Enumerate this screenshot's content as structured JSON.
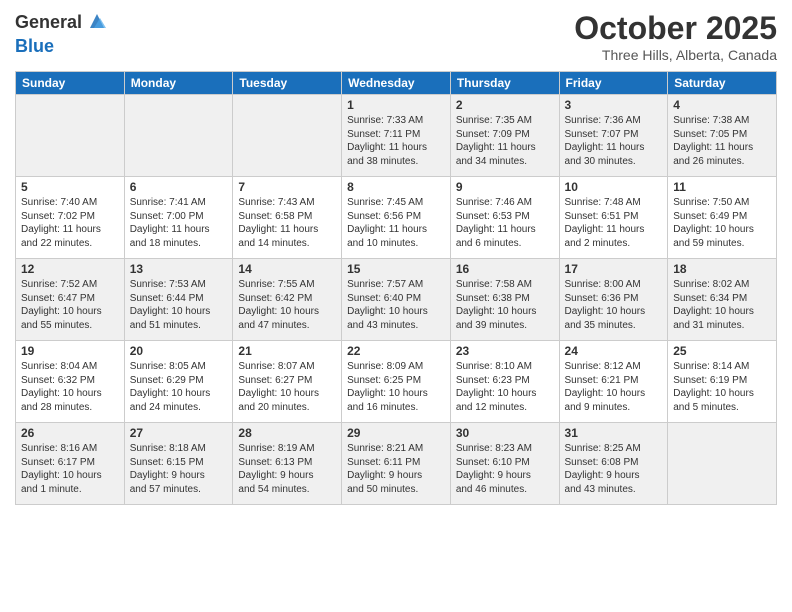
{
  "logo": {
    "general": "General",
    "blue": "Blue"
  },
  "title": "October 2025",
  "location": "Three Hills, Alberta, Canada",
  "weekdays": [
    "Sunday",
    "Monday",
    "Tuesday",
    "Wednesday",
    "Thursday",
    "Friday",
    "Saturday"
  ],
  "weeks": [
    [
      {
        "day": "",
        "info": ""
      },
      {
        "day": "",
        "info": ""
      },
      {
        "day": "",
        "info": ""
      },
      {
        "day": "1",
        "info": "Sunrise: 7:33 AM\nSunset: 7:11 PM\nDaylight: 11 hours\nand 38 minutes."
      },
      {
        "day": "2",
        "info": "Sunrise: 7:35 AM\nSunset: 7:09 PM\nDaylight: 11 hours\nand 34 minutes."
      },
      {
        "day": "3",
        "info": "Sunrise: 7:36 AM\nSunset: 7:07 PM\nDaylight: 11 hours\nand 30 minutes."
      },
      {
        "day": "4",
        "info": "Sunrise: 7:38 AM\nSunset: 7:05 PM\nDaylight: 11 hours\nand 26 minutes."
      }
    ],
    [
      {
        "day": "5",
        "info": "Sunrise: 7:40 AM\nSunset: 7:02 PM\nDaylight: 11 hours\nand 22 minutes."
      },
      {
        "day": "6",
        "info": "Sunrise: 7:41 AM\nSunset: 7:00 PM\nDaylight: 11 hours\nand 18 minutes."
      },
      {
        "day": "7",
        "info": "Sunrise: 7:43 AM\nSunset: 6:58 PM\nDaylight: 11 hours\nand 14 minutes."
      },
      {
        "day": "8",
        "info": "Sunrise: 7:45 AM\nSunset: 6:56 PM\nDaylight: 11 hours\nand 10 minutes."
      },
      {
        "day": "9",
        "info": "Sunrise: 7:46 AM\nSunset: 6:53 PM\nDaylight: 11 hours\nand 6 minutes."
      },
      {
        "day": "10",
        "info": "Sunrise: 7:48 AM\nSunset: 6:51 PM\nDaylight: 11 hours\nand 2 minutes."
      },
      {
        "day": "11",
        "info": "Sunrise: 7:50 AM\nSunset: 6:49 PM\nDaylight: 10 hours\nand 59 minutes."
      }
    ],
    [
      {
        "day": "12",
        "info": "Sunrise: 7:52 AM\nSunset: 6:47 PM\nDaylight: 10 hours\nand 55 minutes."
      },
      {
        "day": "13",
        "info": "Sunrise: 7:53 AM\nSunset: 6:44 PM\nDaylight: 10 hours\nand 51 minutes."
      },
      {
        "day": "14",
        "info": "Sunrise: 7:55 AM\nSunset: 6:42 PM\nDaylight: 10 hours\nand 47 minutes."
      },
      {
        "day": "15",
        "info": "Sunrise: 7:57 AM\nSunset: 6:40 PM\nDaylight: 10 hours\nand 43 minutes."
      },
      {
        "day": "16",
        "info": "Sunrise: 7:58 AM\nSunset: 6:38 PM\nDaylight: 10 hours\nand 39 minutes."
      },
      {
        "day": "17",
        "info": "Sunrise: 8:00 AM\nSunset: 6:36 PM\nDaylight: 10 hours\nand 35 minutes."
      },
      {
        "day": "18",
        "info": "Sunrise: 8:02 AM\nSunset: 6:34 PM\nDaylight: 10 hours\nand 31 minutes."
      }
    ],
    [
      {
        "day": "19",
        "info": "Sunrise: 8:04 AM\nSunset: 6:32 PM\nDaylight: 10 hours\nand 28 minutes."
      },
      {
        "day": "20",
        "info": "Sunrise: 8:05 AM\nSunset: 6:29 PM\nDaylight: 10 hours\nand 24 minutes."
      },
      {
        "day": "21",
        "info": "Sunrise: 8:07 AM\nSunset: 6:27 PM\nDaylight: 10 hours\nand 20 minutes."
      },
      {
        "day": "22",
        "info": "Sunrise: 8:09 AM\nSunset: 6:25 PM\nDaylight: 10 hours\nand 16 minutes."
      },
      {
        "day": "23",
        "info": "Sunrise: 8:10 AM\nSunset: 6:23 PM\nDaylight: 10 hours\nand 12 minutes."
      },
      {
        "day": "24",
        "info": "Sunrise: 8:12 AM\nSunset: 6:21 PM\nDaylight: 10 hours\nand 9 minutes."
      },
      {
        "day": "25",
        "info": "Sunrise: 8:14 AM\nSunset: 6:19 PM\nDaylight: 10 hours\nand 5 minutes."
      }
    ],
    [
      {
        "day": "26",
        "info": "Sunrise: 8:16 AM\nSunset: 6:17 PM\nDaylight: 10 hours\nand 1 minute."
      },
      {
        "day": "27",
        "info": "Sunrise: 8:18 AM\nSunset: 6:15 PM\nDaylight: 9 hours\nand 57 minutes."
      },
      {
        "day": "28",
        "info": "Sunrise: 8:19 AM\nSunset: 6:13 PM\nDaylight: 9 hours\nand 54 minutes."
      },
      {
        "day": "29",
        "info": "Sunrise: 8:21 AM\nSunset: 6:11 PM\nDaylight: 9 hours\nand 50 minutes."
      },
      {
        "day": "30",
        "info": "Sunrise: 8:23 AM\nSunset: 6:10 PM\nDaylight: 9 hours\nand 46 minutes."
      },
      {
        "day": "31",
        "info": "Sunrise: 8:25 AM\nSunset: 6:08 PM\nDaylight: 9 hours\nand 43 minutes."
      },
      {
        "day": "",
        "info": ""
      }
    ]
  ]
}
